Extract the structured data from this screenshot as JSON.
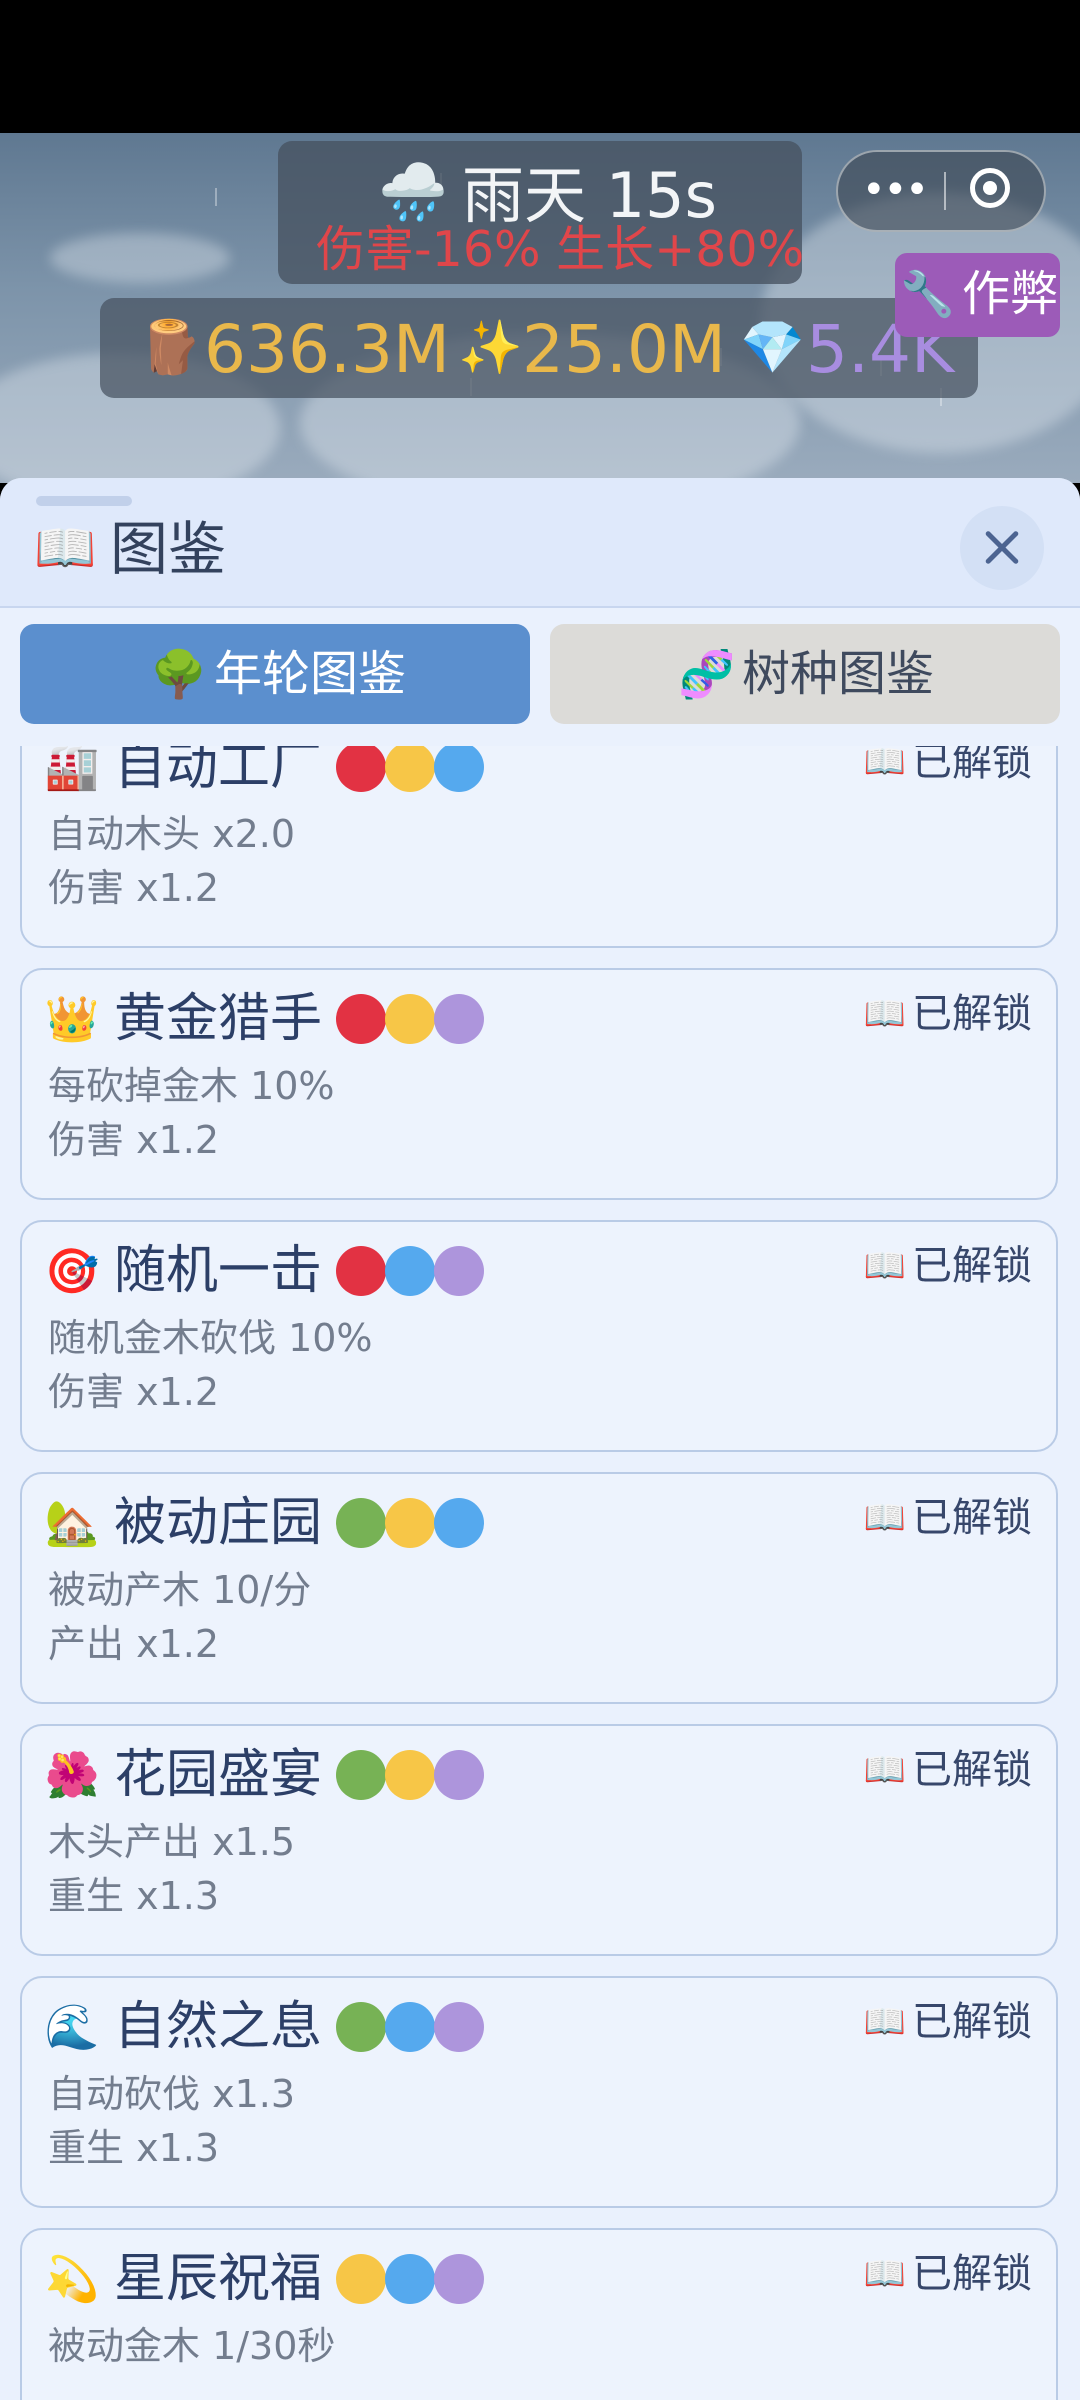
{
  "weather": {
    "icon": "🌧️",
    "name": "雨天 15s",
    "effects": "伤害-16% 生长+80%"
  },
  "resources": [
    {
      "icon": "🪵",
      "value": "636.3M",
      "color": "#e9b84b"
    },
    {
      "icon": "✨",
      "value": "25.0M",
      "color": "#e9b84b"
    },
    {
      "icon": "💎",
      "value": "5.4K",
      "color": "#a88de0"
    }
  ],
  "capsule": {
    "more_icon": "more-dots-icon",
    "close_icon": "exit-circle-icon"
  },
  "cheat": {
    "icon": "🔧",
    "label": "作弊"
  },
  "panel": {
    "icon": "📖",
    "title": "图鉴"
  },
  "tabs": [
    {
      "icon": "🌳",
      "label": "年轮图鉴",
      "active": true
    },
    {
      "icon": "🧬",
      "label": "树种图鉴",
      "active": false
    }
  ],
  "colors": {
    "red": "#e23243",
    "yellow": "#f7c647",
    "blue": "#55a9ee",
    "purple": "#ad95dc",
    "green": "#77b255",
    "tab_active": "#5b8fce"
  },
  "cards": [
    {
      "icon": "🏭",
      "name": "自动工厂",
      "dots": [
        "red",
        "yellow",
        "blue"
      ],
      "status_icon": "📖",
      "status": "已解锁",
      "line1": "自动木头 x2.0",
      "line2": "伤害 x1.2"
    },
    {
      "icon": "👑",
      "name": "黄金猎手",
      "dots": [
        "red",
        "yellow",
        "purple"
      ],
      "status_icon": "📖",
      "status": "已解锁",
      "line1": "每砍掉金木 10%",
      "line2": "伤害 x1.2"
    },
    {
      "icon": "🎯",
      "name": "随机一击",
      "dots": [
        "red",
        "blue",
        "purple"
      ],
      "status_icon": "📖",
      "status": "已解锁",
      "line1": "随机金木砍伐 10%",
      "line2": "伤害 x1.2"
    },
    {
      "icon": "🏡",
      "name": "被动庄园",
      "dots": [
        "green",
        "yellow",
        "blue"
      ],
      "status_icon": "📖",
      "status": "已解锁",
      "line1": "被动产木 10/分",
      "line2": "产出 x1.2"
    },
    {
      "icon": "🌺",
      "name": "花园盛宴",
      "dots": [
        "green",
        "yellow",
        "purple"
      ],
      "status_icon": "📖",
      "status": "已解锁",
      "line1": "木头产出 x1.5",
      "line2": "重生 x1.3"
    },
    {
      "icon": "🌊",
      "name": "自然之息",
      "dots": [
        "green",
        "blue",
        "purple"
      ],
      "status_icon": "📖",
      "status": "已解锁",
      "line1": "自动砍伐 x1.3",
      "line2": "重生 x1.3"
    },
    {
      "icon": "💫",
      "name": "星辰祝福",
      "dots": [
        "yellow",
        "blue",
        "purple"
      ],
      "status_icon": "📖",
      "status": "已解锁",
      "line1": "被动金木 1/30秒",
      "line2": ""
    }
  ]
}
